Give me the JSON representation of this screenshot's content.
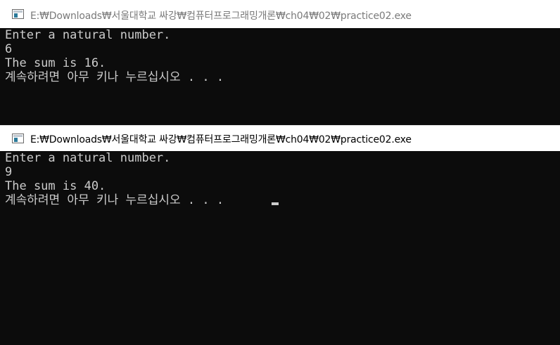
{
  "windows": [
    {
      "title": "E:₩Downloads₩서울대학교 싸강₩컴퓨터프로그래밍개론₩ch04₩02₩practice02.exe",
      "lines": [
        "Enter a natural number.",
        "6",
        "The sum is 16.",
        "계속하려면 아무 키나 누르십시오 . . ."
      ]
    },
    {
      "title": "E:₩Downloads₩서울대학교 싸강₩컴퓨터프로그래밍개론₩ch04₩02₩practice02.exe",
      "lines": [
        "Enter a natural number.",
        "9",
        "The sum is 40.",
        "계속하려면 아무 키나 누르십시오 . . ."
      ]
    }
  ],
  "icons": {
    "app": "console-window-icon",
    "cursor": "text-cursor"
  },
  "colors": {
    "console_bg": "#0c0c0c",
    "console_text": "#cccccc",
    "titlebar_bg": "#ffffff"
  }
}
